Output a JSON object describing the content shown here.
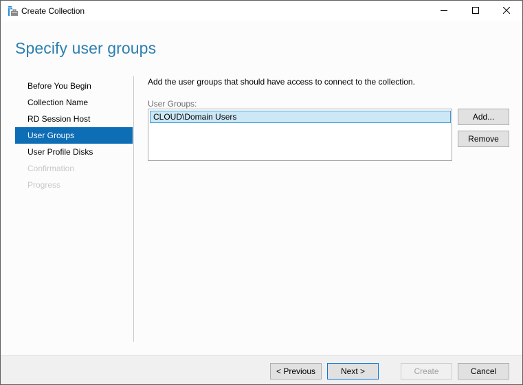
{
  "window": {
    "title": "Create Collection",
    "icon": "collection-app-icon",
    "controls": {
      "minimize": "minimize-icon",
      "maximize": "maximize-icon",
      "close": "close-icon"
    }
  },
  "header": {
    "title": "Specify user groups"
  },
  "nav": {
    "items": [
      {
        "label": "Before You Begin",
        "state": "normal"
      },
      {
        "label": "Collection Name",
        "state": "normal"
      },
      {
        "label": "RD Session Host",
        "state": "normal"
      },
      {
        "label": "User Groups",
        "state": "selected"
      },
      {
        "label": "User Profile Disks",
        "state": "normal"
      },
      {
        "label": "Confirmation",
        "state": "disabled"
      },
      {
        "label": "Progress",
        "state": "disabled"
      }
    ]
  },
  "main": {
    "description": "Add the user groups that should have access to connect to the collection.",
    "list_label": "User Groups:",
    "user_groups": [
      "CLOUD\\Domain Users"
    ],
    "add_label": "Add...",
    "remove_label": "Remove"
  },
  "footer": {
    "previous_label": "< Previous",
    "next_label": "Next >",
    "create_label": "Create",
    "cancel_label": "Cancel"
  },
  "colors": {
    "accent": "#0d6db5",
    "header_text": "#2a7fb0",
    "selection_bg": "#cce8f6",
    "selection_border": "#3c9bd6"
  }
}
